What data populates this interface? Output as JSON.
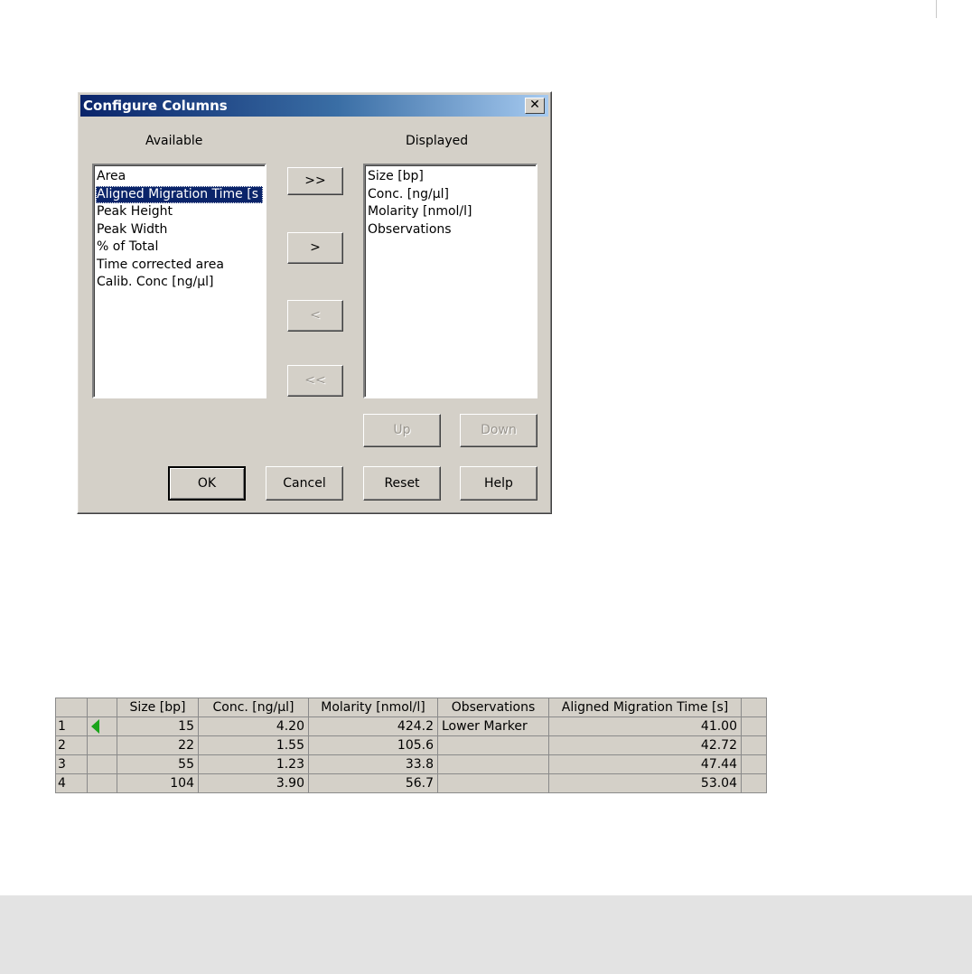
{
  "dialog": {
    "title": "Configure Columns",
    "close_glyph": "✕",
    "available_label": "Available",
    "displayed_label": "Displayed",
    "available_items": [
      "Area",
      "Aligned Migration Time [s",
      "Peak Height",
      "Peak Width",
      "% of Total",
      "Time corrected area",
      "Calib. Conc [ng/µl]"
    ],
    "selected_available_index": 1,
    "displayed_items": [
      "Size [bp]",
      "Conc. [ng/µl]",
      "Molarity [nmol/l]",
      "Observations"
    ],
    "buttons": {
      "add_all": ">>",
      "add": ">",
      "remove": "<",
      "remove_all": "<<",
      "up": "Up",
      "down": "Down",
      "ok": "OK",
      "cancel": "Cancel",
      "reset": "Reset",
      "help": "Help"
    }
  },
  "table": {
    "headers": [
      "",
      "",
      "Size [bp]",
      "Conc. [ng/µl]",
      "Molarity [nmol/l]",
      "Observations",
      "Aligned Migration Time [s]",
      ""
    ],
    "rows": [
      {
        "index": "1",
        "size": "15",
        "conc": "4.20",
        "molarity": "424.2",
        "observations": "Lower Marker",
        "amt": "41.00"
      },
      {
        "index": "2",
        "size": "22",
        "conc": "1.55",
        "molarity": "105.6",
        "observations": "",
        "amt": "42.72"
      },
      {
        "index": "3",
        "size": "55",
        "conc": "1.23",
        "molarity": "33.8",
        "observations": "",
        "amt": "47.44"
      },
      {
        "index": "4",
        "size": "104",
        "conc": "3.90",
        "molarity": "56.7",
        "observations": "",
        "amt": "53.04"
      }
    ],
    "marker_color": "#1aa41a"
  }
}
